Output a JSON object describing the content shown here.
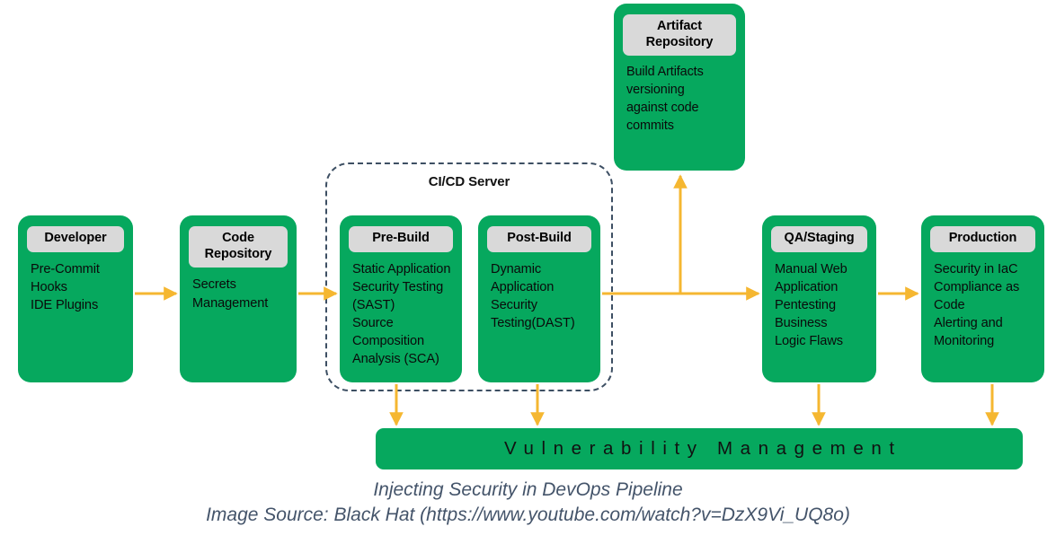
{
  "diagram": {
    "cicd_container": {
      "label": "CI/CD Server"
    },
    "nodes": [
      {
        "id": "developer",
        "title": "Developer",
        "items": [
          "Pre-Commit",
          "Hooks",
          "IDE Plugins"
        ]
      },
      {
        "id": "code-repository",
        "title": "Code Repository",
        "items": [
          "Secrets",
          "Management"
        ]
      },
      {
        "id": "pre-build",
        "title": "Pre-Build",
        "items": [
          "Static Application",
          "Security Testing",
          "(SAST)",
          "Source",
          "Composition",
          "Analysis (SCA)"
        ]
      },
      {
        "id": "post-build",
        "title": "Post-Build",
        "items": [
          "Dynamic",
          "Application",
          "Security",
          "Testing(DAST)"
        ]
      },
      {
        "id": "artifact-repository",
        "title": "Artifact Repository",
        "title_line1": "Artifact",
        "title_line2": "Repository",
        "items": [
          "Build Artifacts",
          "versioning",
          "against code",
          "commits"
        ]
      },
      {
        "id": "qa-staging",
        "title": "QA/Staging",
        "items": [
          "Manual Web",
          "Application",
          "Pentesting",
          "Business",
          "Logic Flaws"
        ]
      },
      {
        "id": "production",
        "title": "Production",
        "items": [
          "Security in IaC",
          "Compliance as",
          "Code",
          "Alerting and",
          "Monitoring"
        ]
      }
    ],
    "vulnerability_bar": {
      "label": "Vulnerability Management"
    },
    "colors": {
      "node_green": "#06a85e",
      "node_title_gray": "#d9d9d9",
      "arrow_amber": "#f5b731",
      "dashed_border": "#3d4f63",
      "caption_text": "#44546a"
    }
  },
  "caption": {
    "line1": "Injecting Security in DevOps Pipeline",
    "line2": "Image Source: Black Hat (https://www.youtube.com/watch?v=DzX9Vi_UQ8o)"
  }
}
